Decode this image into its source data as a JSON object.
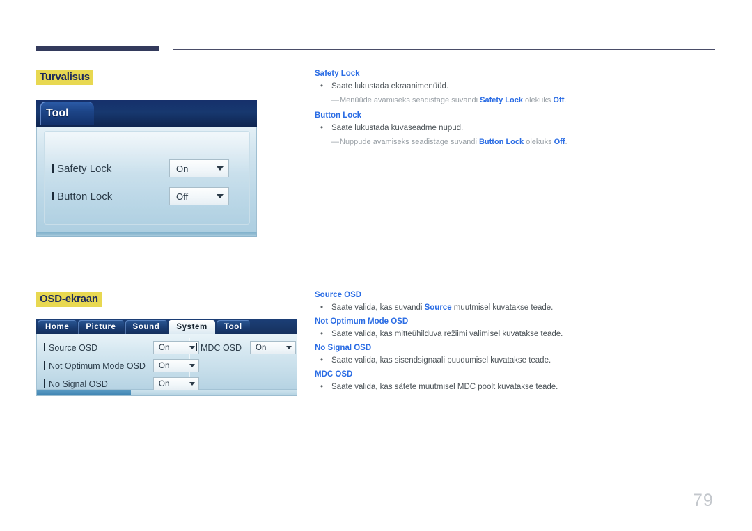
{
  "page": {
    "number": "79"
  },
  "sections": [
    {
      "title": "Turvalisus",
      "panel": {
        "type": "tool-panel",
        "tab_label": "Tool",
        "rows": [
          {
            "label": "Safety Lock",
            "value": "On"
          },
          {
            "label": "Button Lock",
            "value": "Off"
          }
        ]
      },
      "descriptions": [
        {
          "heading": "Safety Lock",
          "bullet": "Saate lukustada ekraanimenüüd.",
          "note_prefix": "Menüüde avamiseks seadistage suvandi ",
          "note_term": "Safety Lock",
          "note_middle": " olekuks ",
          "note_value": "Off",
          "note_suffix": "."
        },
        {
          "heading": "Button Lock",
          "bullet": "Saate lukustada kuvaseadme nupud.",
          "note_prefix": "Nuppude avamiseks seadistage suvandi ",
          "note_term": "Button Lock",
          "note_middle": " olekuks ",
          "note_value": "Off",
          "note_suffix": "."
        }
      ]
    },
    {
      "title": "OSD-ekraan",
      "panel": {
        "type": "system-panel",
        "tabs": [
          {
            "label": "Home",
            "active": false
          },
          {
            "label": "Picture",
            "active": false
          },
          {
            "label": "Sound",
            "active": false
          },
          {
            "label": "System",
            "active": true
          },
          {
            "label": "Tool",
            "active": false
          }
        ],
        "rows_left": [
          {
            "label": "Source OSD",
            "value": "On"
          },
          {
            "label": "Not Optimum Mode OSD",
            "value": "On"
          },
          {
            "label": "No Signal OSD",
            "value": "On"
          }
        ],
        "rows_right": [
          {
            "label": "MDC OSD",
            "value": "On"
          }
        ]
      },
      "descriptions": [
        {
          "heading": "Source OSD",
          "bullet_prefix": "Saate valida, kas suvandi ",
          "bullet_term": "Source",
          "bullet_suffix": " muutmisel kuvatakse teade."
        },
        {
          "heading": "Not Optimum Mode OSD",
          "bullet": "Saate valida, kas mitteühilduva režiimi valimisel kuvatakse teade."
        },
        {
          "heading": "No Signal OSD",
          "bullet": "Saate valida, kas sisendsignaali puudumisel kuvatakse teade."
        },
        {
          "heading": "MDC OSD",
          "bullet": "Saate valida, kas sätete muutmisel MDC poolt kuvatakse teade."
        }
      ]
    }
  ],
  "symbols": {
    "bullet": "•",
    "dash": "—"
  },
  "colors": {
    "highlight": "#e8d851",
    "heading_blue": "#2a6ce4",
    "body_gray": "#4d5459",
    "note_gray": "#9aa1a7",
    "rule_navy": "#333a5c"
  }
}
